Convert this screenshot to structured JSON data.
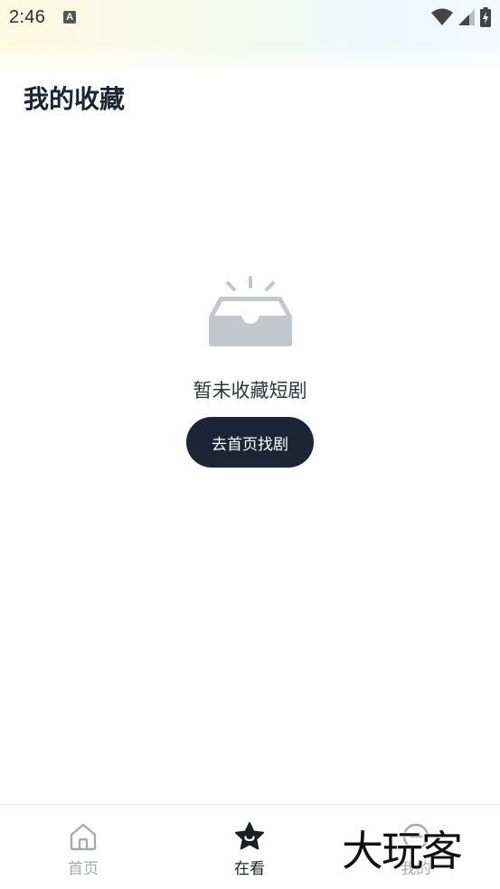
{
  "status_bar": {
    "time": "2:46",
    "notification_icon": "a-letter-icon",
    "icons": [
      "wifi-icon",
      "signal-icon",
      "battery-icon"
    ]
  },
  "header": {
    "title": "我的收藏"
  },
  "empty_state": {
    "icon": "empty-inbox-icon",
    "message": "暂未收藏短剧",
    "button_label": "去首页找剧"
  },
  "tab_bar": {
    "items": [
      {
        "label": "首页",
        "icon": "home-icon",
        "active": false
      },
      {
        "label": "在看",
        "icon": "star-icon",
        "active": true
      },
      {
        "label": "我的",
        "icon": "profile-icon",
        "active": false
      }
    ]
  },
  "watermark": {
    "text": "大玩客"
  },
  "colors": {
    "title": "#1b2431",
    "button_bg": "#1b2535",
    "button_text": "#ffffff",
    "tab_active": "#1c1f24",
    "tab_inactive": "#a6a9ad",
    "empty_icon": "#c3c7cc"
  }
}
